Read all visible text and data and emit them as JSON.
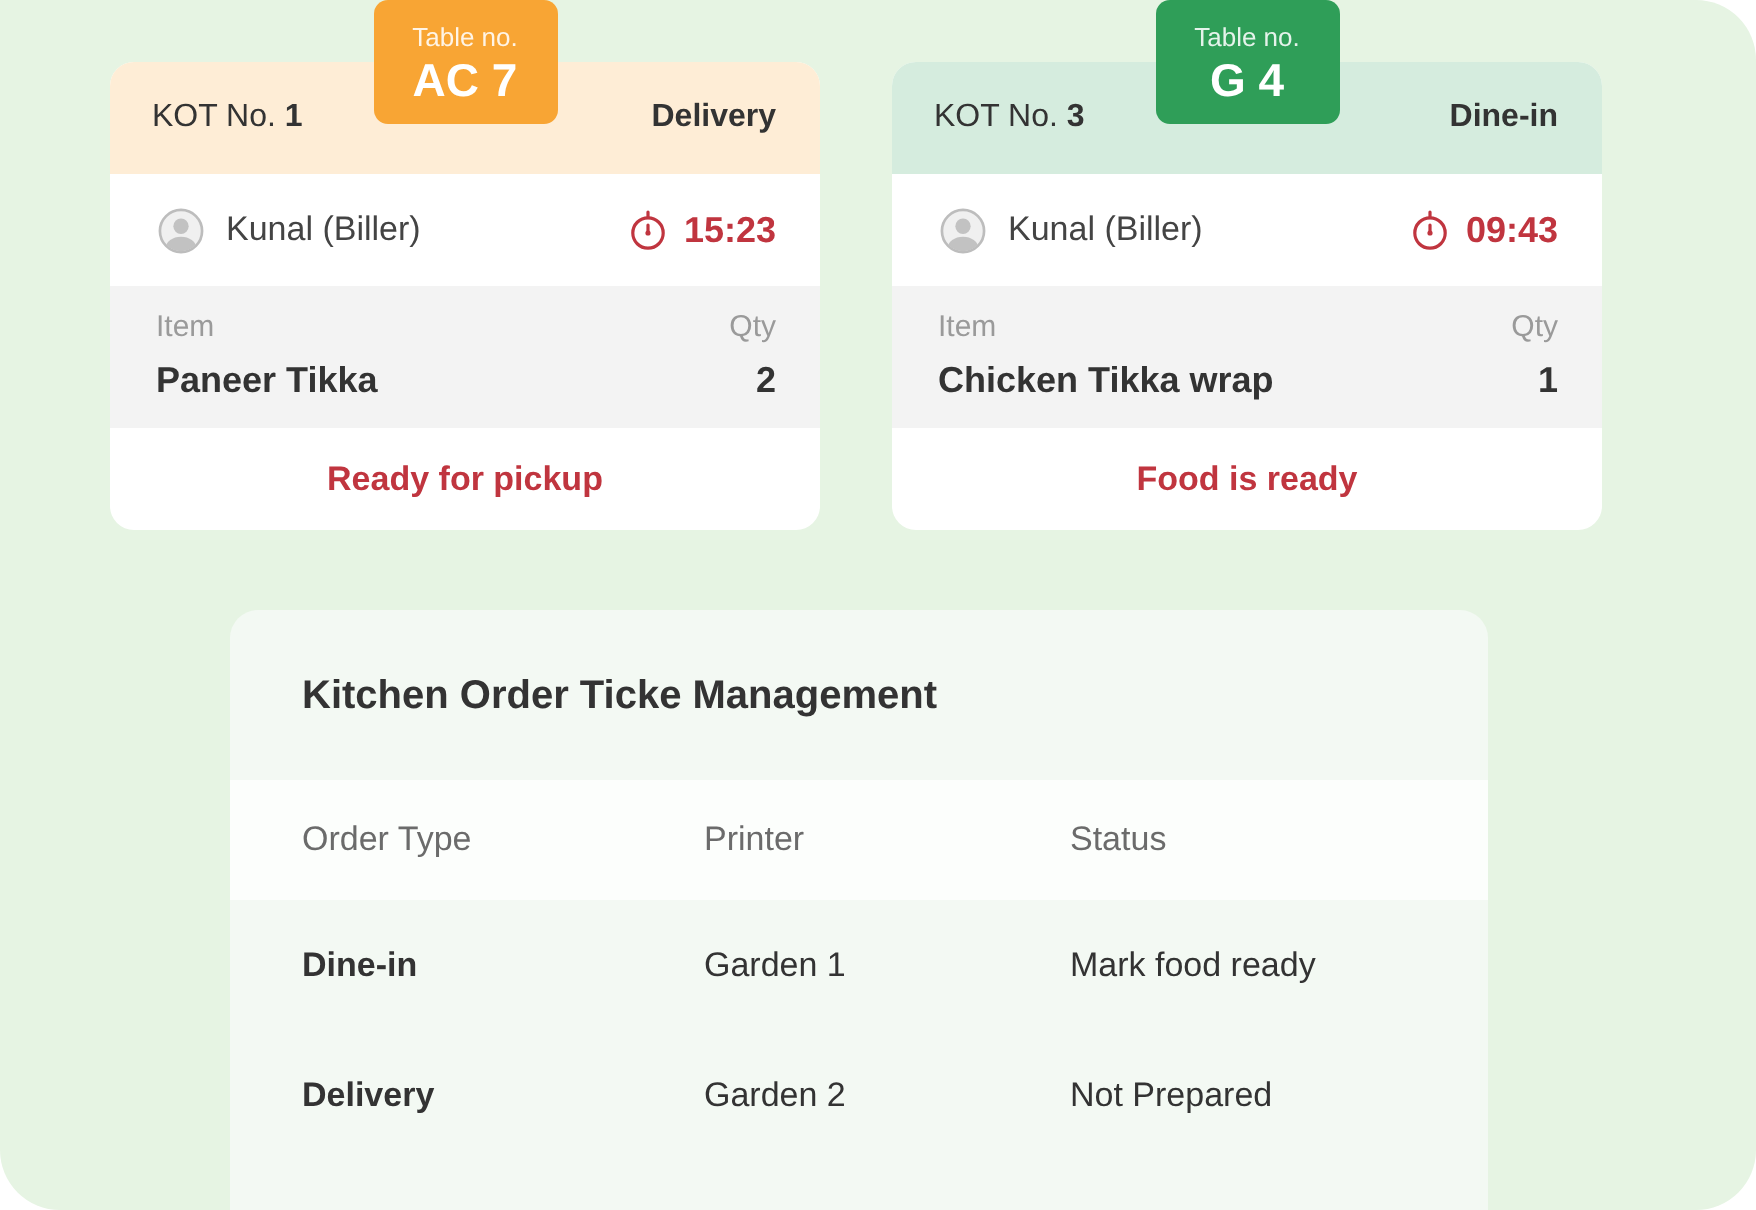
{
  "tickets": [
    {
      "table_label": "Table no.",
      "table_number": "AC 7",
      "color": "#f8a534",
      "kot": "KOT No. **1**",
      "order_type": "Delivery",
      "biller": "Kunal (Biller)",
      "timer": "15:23",
      "item_heading": "Item",
      "qty_heading": "Qty",
      "items": [
        {
          "name": "Paneer Tikka",
          "qty": "2"
        }
      ],
      "status": "Ready for pickup"
    },
    {
      "table_label": "Table no.",
      "table_number": "G 4",
      "color": "#2f9e58",
      "kot": "KOT No. **3**",
      "order_type": "Dine-in",
      "biller": "Kunal (Biller)",
      "timer": "09:43",
      "item_heading": "Item",
      "qty_heading": "Qty",
      "items": [
        {
          "name": "Chicken Tikka wrap",
          "qty": "1"
        }
      ],
      "status": "Food is ready"
    }
  ],
  "kitchen_panel": {
    "title": "Kitchen Order Ticke Management",
    "columns": [
      "Order Type",
      "Printer",
      "Status"
    ],
    "rows": [
      [
        "Dine-in",
        "Garden 1",
        "Mark food ready"
      ],
      [
        "Delivery",
        "Garden 2",
        "Not Prepared"
      ]
    ]
  }
}
